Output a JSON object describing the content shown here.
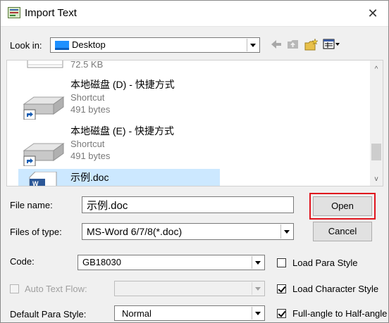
{
  "window": {
    "title": "Import Text",
    "close_glyph": "✕"
  },
  "look_in": {
    "label": "Look in:",
    "value": "Desktop"
  },
  "toolbar": {
    "icons": [
      "back-arrow-icon",
      "up-folder-icon",
      "new-folder-icon",
      "view-menu-icon"
    ]
  },
  "file_list": {
    "partial_size": "72.5 KB",
    "items": [
      {
        "name": "本地磁盘 (D) - 快捷方式",
        "type": "Shortcut",
        "size": "491 bytes"
      },
      {
        "name": "本地磁盘 (E) - 快捷方式",
        "type": "Shortcut",
        "size": "491 bytes"
      },
      {
        "name": "示例.doc",
        "selected": true
      }
    ]
  },
  "file_name": {
    "label": "File name:",
    "value": "示例.doc"
  },
  "files_of_type": {
    "label": "Files of type:",
    "value": "MS-Word 6/7/8(*.doc)"
  },
  "buttons": {
    "open": "Open",
    "cancel": "Cancel"
  },
  "code": {
    "label": "Code:",
    "value": "GB18030"
  },
  "load_para_style": {
    "label": "Load Para Style",
    "checked": false
  },
  "auto_text_flow": {
    "label": "Auto Text Flow:",
    "value": "",
    "enabled": false
  },
  "load_character_style": {
    "label": "Load Character Style",
    "checked": true
  },
  "default_para_style": {
    "label": "Default Para Style:",
    "value": "Normal"
  },
  "full_angle": {
    "label": "Full-angle to Half-angle",
    "checked": true
  },
  "colors": {
    "highlight_border": "#e0141e",
    "selection": "#cce8ff",
    "folder_blue": "#1e90ff"
  }
}
